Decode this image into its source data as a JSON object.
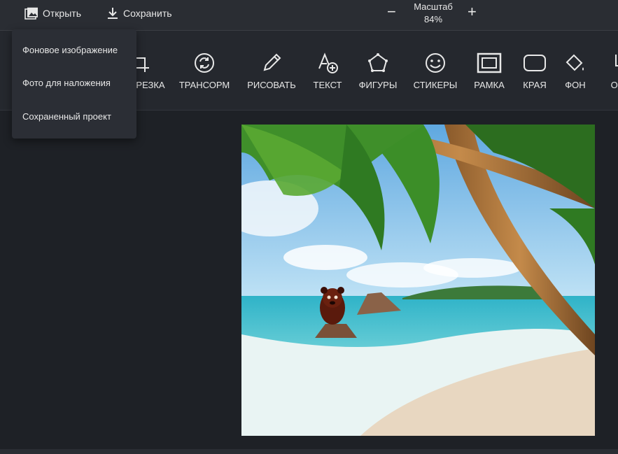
{
  "topbar": {
    "open_label": "Открыть",
    "save_label": "Сохранить",
    "zoom_title": "Масштаб",
    "zoom_value": "84%",
    "zoom_minus": "−",
    "zoom_plus": "+"
  },
  "dropdown": {
    "items": [
      "Фоновое изображение",
      "Фото для наложения",
      "Сохраненный проект"
    ]
  },
  "toolbar": {
    "tools": [
      {
        "label": "РЕЗКА",
        "icon": "crop-icon"
      },
      {
        "label": "ТРАНСОРМ",
        "icon": "rotate-icon"
      },
      {
        "label": "РИСОВАТЬ",
        "icon": "pencil-icon"
      },
      {
        "label": "ТЕКСТ",
        "icon": "text-add-icon"
      },
      {
        "label": "ФИГУРЫ",
        "icon": "shapes-icon"
      },
      {
        "label": "СТИКЕРЫ",
        "icon": "smiley-icon"
      },
      {
        "label": "РАМКА",
        "icon": "frame-icon"
      },
      {
        "label": "КРАЯ",
        "icon": "rounded-corners-icon"
      },
      {
        "label": "ФОН",
        "icon": "paint-bucket-icon"
      },
      {
        "label": "ОБ",
        "icon": "overlay-icon"
      }
    ]
  },
  "colors": {
    "topbar_bg": "#2a2d33",
    "toolbar_bg": "#25282e",
    "canvas_bg": "#1e2126",
    "menu_bg": "#2b2e35"
  }
}
